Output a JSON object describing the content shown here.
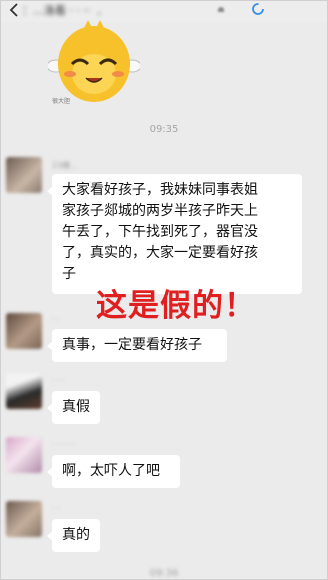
{
  "header": {
    "title": "：…洛看 · · ··  ,"
  },
  "sticker": {
    "caption": "很大胆"
  },
  "times": {
    "top": "09:35",
    "bottom": "09:36"
  },
  "messages": [
    {
      "nickname": "23楼…",
      "lines": [
        "大家看好孩子，我妹妹同事表姐",
        "家孩子郯城的两岁半孩子昨天上",
        "午丢了，下午找到死了，器官没",
        "了，真实的，大家一定要看好孩",
        "子"
      ]
    },
    {
      "nickname": "· ·",
      "lines": [
        "真事，一定要看好孩子"
      ]
    },
    {
      "nickname": "· · ·",
      "lines": [
        "真假"
      ]
    },
    {
      "nickname": "· · · · ·",
      "lines": [
        "啊，太吓人了吧"
      ]
    },
    {
      "nickname": "· ·",
      "lines": [
        "真的"
      ]
    }
  ],
  "overlay": {
    "text": "这是假的！",
    "color": "#e02020"
  },
  "colors": {
    "background": "#ebebeb",
    "bubble": "#ffffff",
    "time": "#a5a5a5"
  }
}
